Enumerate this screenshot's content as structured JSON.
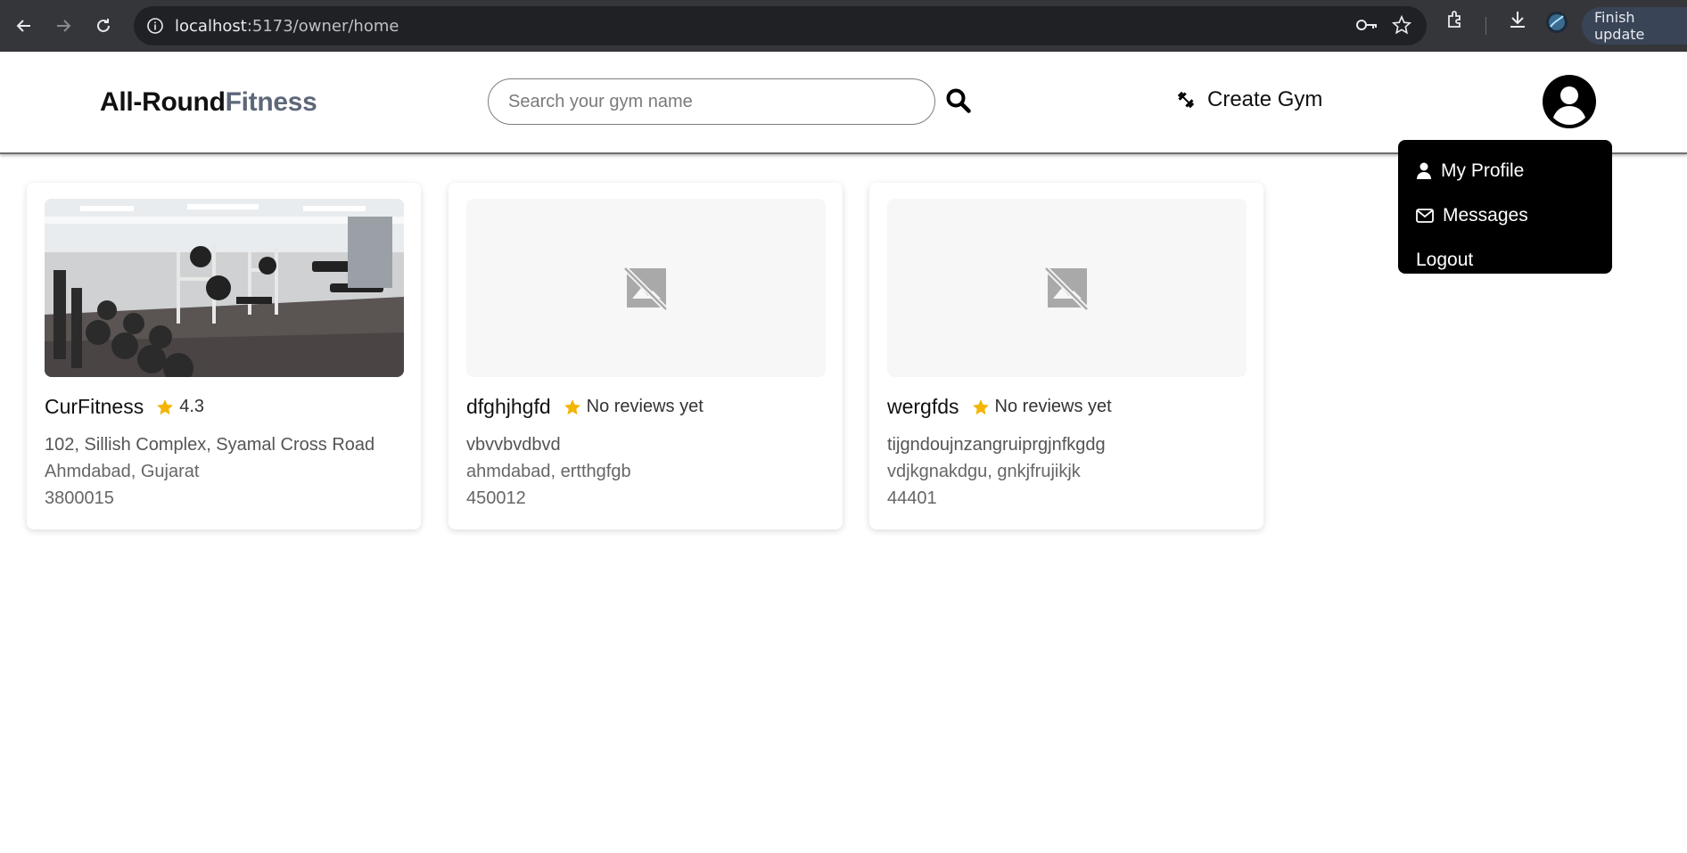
{
  "browser": {
    "url_host": "localhost",
    "url_path": ":5173/owner/home",
    "finish_update_label": "Finish update"
  },
  "header": {
    "logo_main": "All-Round",
    "logo_accent": "Fitness",
    "search_placeholder": "Search your gym name",
    "create_gym_label": "Create Gym"
  },
  "dropdown": {
    "items": [
      {
        "label": "My Profile",
        "icon": "person-icon"
      },
      {
        "label": "Messages",
        "icon": "envelope-icon"
      },
      {
        "label": "Logout",
        "icon": ""
      }
    ]
  },
  "gyms": [
    {
      "name": "CurFitness",
      "rating": "4.3",
      "address_line": "102, Sillish Complex, Syamal Cross Road",
      "city_state": "Ahmdabad, Gujarat",
      "pincode": "3800015",
      "image": "gym-photo"
    },
    {
      "name": "dfghjhgfd",
      "rating": "No reviews yet",
      "address_line": "vbvvbvdbvd",
      "city_state": "ahmdabad, ertthgfgb",
      "pincode": "450012",
      "image": "no-image-icon"
    },
    {
      "name": "wergfds",
      "rating": "No reviews yet",
      "address_line": "tijgndoujnzangruiprgjnfkgdg",
      "city_state": "vdjkgnakdgu, gnkjfrujikjk",
      "pincode": "44401",
      "image": "no-image-icon"
    }
  ],
  "colors": {
    "star": "#f4b400",
    "logo_accent": "#5d6778",
    "dropdown_bg": "#000000",
    "chrome_bg": "#35363a"
  }
}
